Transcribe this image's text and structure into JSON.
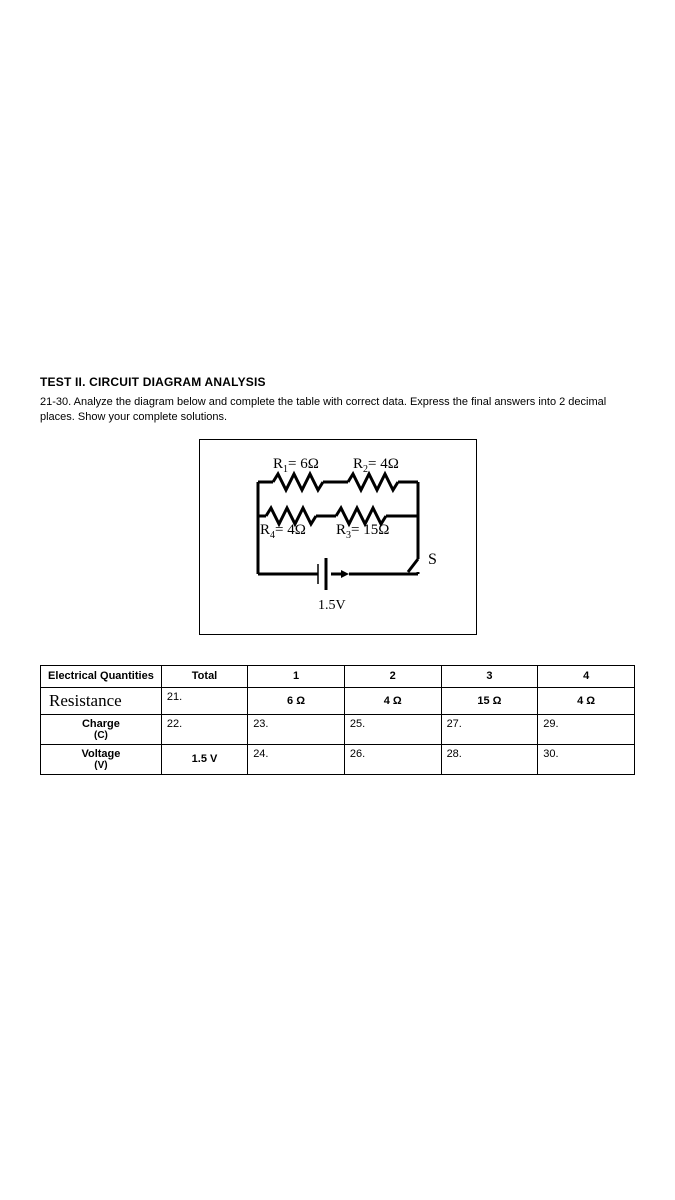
{
  "title": "TEST II. CIRCUIT DIAGRAM ANALYSIS",
  "instructions": "21-30. Analyze the diagram below and complete the table with correct data. Express the final answers into 2 decimal places. Show your complete solutions.",
  "circuit": {
    "r1": {
      "name": "R",
      "sub": "1",
      "val": "= 6Ω"
    },
    "r2": {
      "name": "R",
      "sub": "2",
      "val": "= 4Ω"
    },
    "r3": {
      "name": "R",
      "sub": "3",
      "val": "= 15Ω"
    },
    "r4": {
      "name": "R",
      "sub": "4",
      "val": "= 4Ω"
    },
    "switch": "S",
    "battery_v": "1.5V"
  },
  "table": {
    "h": {
      "eq": "Electrical Quantities",
      "total": "Total",
      "c1": "1",
      "c2": "2",
      "c3": "3",
      "c4": "4"
    },
    "rows": {
      "resistance": {
        "label": "Resistance",
        "total_num": "21.",
        "v1": "6 Ω",
        "v2": "4 Ω",
        "v3": "15 Ω",
        "v4": "4 Ω"
      },
      "charge": {
        "label": "Charge",
        "unit": "(C)",
        "total_num": "22.",
        "n1": "23.",
        "n2": "25.",
        "n3": "27.",
        "n4": "29."
      },
      "voltage": {
        "label": "Voltage",
        "unit": "(V)",
        "total_val": "1.5 V",
        "n1": "24.",
        "n2": "26.",
        "n3": "28.",
        "n4": "30."
      }
    }
  }
}
